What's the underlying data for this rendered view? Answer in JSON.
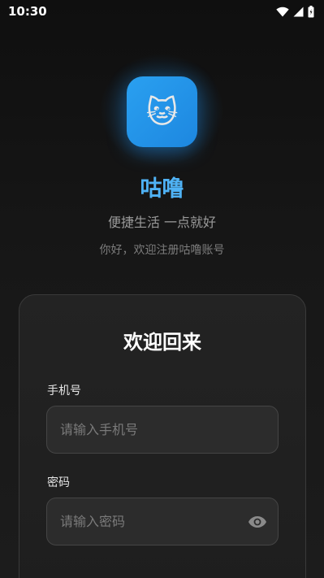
{
  "status_bar": {
    "time": "10:30",
    "icons": [
      "wifi-icon",
      "cellular-signal-icon",
      "battery-icon"
    ]
  },
  "app": {
    "logo_icon": "cat-face-emoji",
    "logo_glyph": "🐱",
    "name": "咕噜",
    "tagline": "便捷生活 一点就好",
    "greeting": "你好，欢迎注册咕噜账号"
  },
  "login_card": {
    "title": "欢迎回来",
    "phone": {
      "label": "手机号",
      "placeholder": "请输入手机号",
      "value": ""
    },
    "password": {
      "label": "密码",
      "placeholder": "请输入密码",
      "value": "",
      "toggle_icon": "eye-icon"
    }
  },
  "colors": {
    "accent": "#4fb2f5",
    "logo_bg": "#1d87e0",
    "background": "#141414",
    "card_bg": "#222222",
    "input_bg": "#2c2c2c"
  }
}
